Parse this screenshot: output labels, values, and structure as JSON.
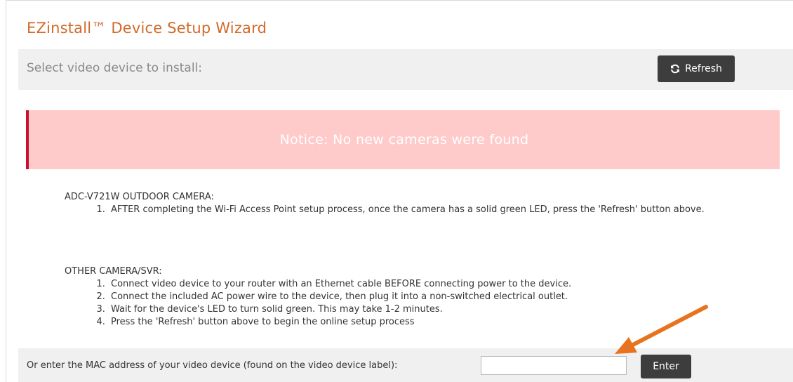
{
  "wizard": {
    "title": "EZinstall™ Device Setup Wizard"
  },
  "select_bar": {
    "label": "Select video device to install:",
    "refresh_label": "Refresh",
    "refresh_icon": "refresh-icon"
  },
  "notice": {
    "text": "Notice: No new cameras were found"
  },
  "instructions": {
    "outdoor": {
      "heading": "ADC-V721W OUTDOOR CAMERA:",
      "steps": [
        "AFTER completing the Wi-Fi Access Point setup process, once the camera has a solid green LED, press the 'Refresh' button above."
      ]
    },
    "other": {
      "heading": "OTHER CAMERA/SVR:",
      "steps": [
        "Connect video device to your router with an Ethernet cable BEFORE connecting power to the device.",
        "Connect the included AC power wire to the device, then plug it into a non-switched electrical outlet.",
        "Wait for the device's LED to turn solid green. This may take 1-2 minutes.",
        "Press the 'Refresh' button above to begin the online setup process"
      ]
    }
  },
  "mac_entry": {
    "label": "Or enter the MAC address of your video device (found on the video device label):",
    "value": "",
    "placeholder": "",
    "enter_label": "Enter"
  },
  "colors": {
    "title": "#d2692a",
    "notice_bg": "#ffcaca",
    "notice_border": "#c8102e",
    "button_bg": "#3d3d3d",
    "bar_bg": "#f0f0f0",
    "annotation_arrow": "#e8731f"
  }
}
